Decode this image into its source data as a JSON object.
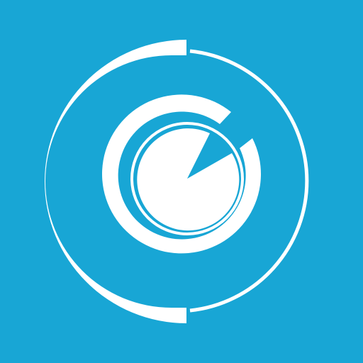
{
  "icon": {
    "name": "radar-target-app-icon",
    "background_color": "#18A6D5",
    "foreground_color": "#FFFFFF"
  }
}
